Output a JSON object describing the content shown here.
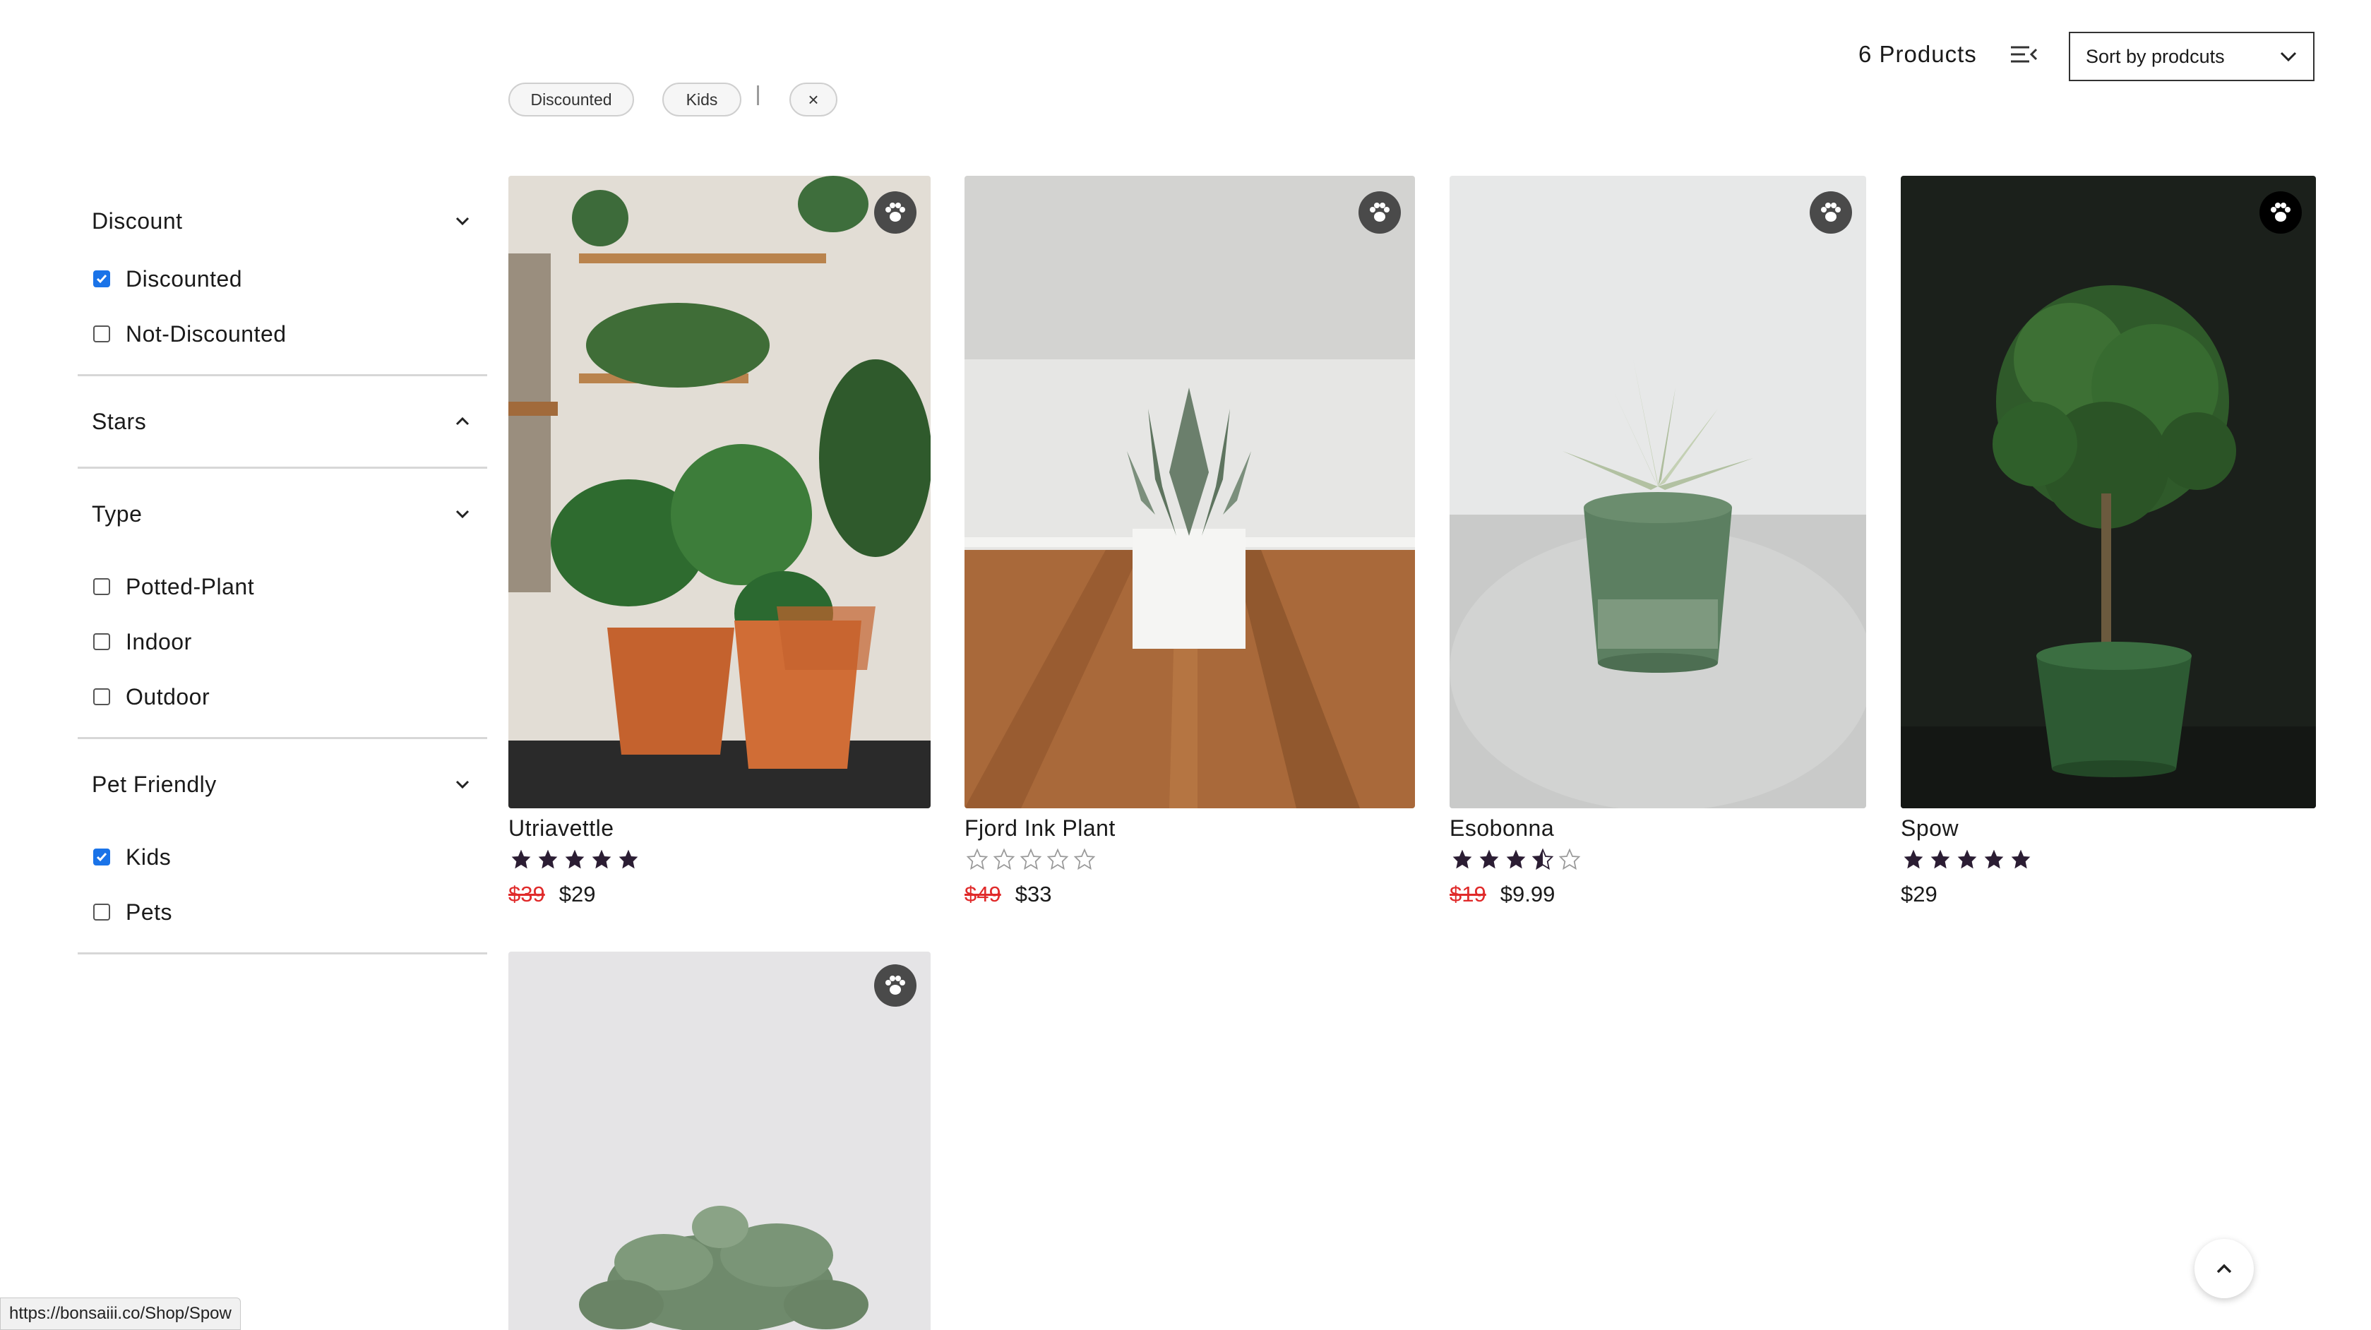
{
  "header": {
    "products_count": "6 Products",
    "sort_label": "Sort by prodcuts"
  },
  "active_filters": [
    "Discounted",
    "Kids"
  ],
  "clear_filters_glyph": "×",
  "filters": {
    "discount": {
      "title": "Discount",
      "options": [
        {
          "label": "Discounted",
          "checked": true
        },
        {
          "label": "Not-Discounted",
          "checked": false
        }
      ]
    },
    "stars": {
      "title": "Stars"
    },
    "type": {
      "title": "Type",
      "options": [
        {
          "label": "Potted-Plant",
          "checked": false
        },
        {
          "label": "Indoor",
          "checked": false
        },
        {
          "label": "Outdoor",
          "checked": false
        }
      ]
    },
    "pet_friendly": {
      "title": "Pet Friendly",
      "options": [
        {
          "label": "Kids",
          "checked": true
        },
        {
          "label": "Pets",
          "checked": false
        }
      ]
    }
  },
  "products": [
    {
      "name": "Utriavettle",
      "rating": 5,
      "old_price": "$39",
      "price": "$29"
    },
    {
      "name": "Fjord Ink Plant",
      "rating": 0,
      "old_price": "$49",
      "price": "$33"
    },
    {
      "name": "Esobonna",
      "rating": 3.5,
      "old_price": "$19",
      "price": "$9.99"
    },
    {
      "name": "Spow",
      "rating": 5,
      "old_price": "",
      "price": "$29"
    },
    {
      "name": "",
      "rating": 0,
      "old_price": "",
      "price": ""
    }
  ],
  "status_url": "https://bonsaiii.co/Shop/Spow",
  "colors": {
    "accent_checkbox": "#1a73e8",
    "sale_red": "#e02a2a",
    "star": "#2b1d33"
  }
}
